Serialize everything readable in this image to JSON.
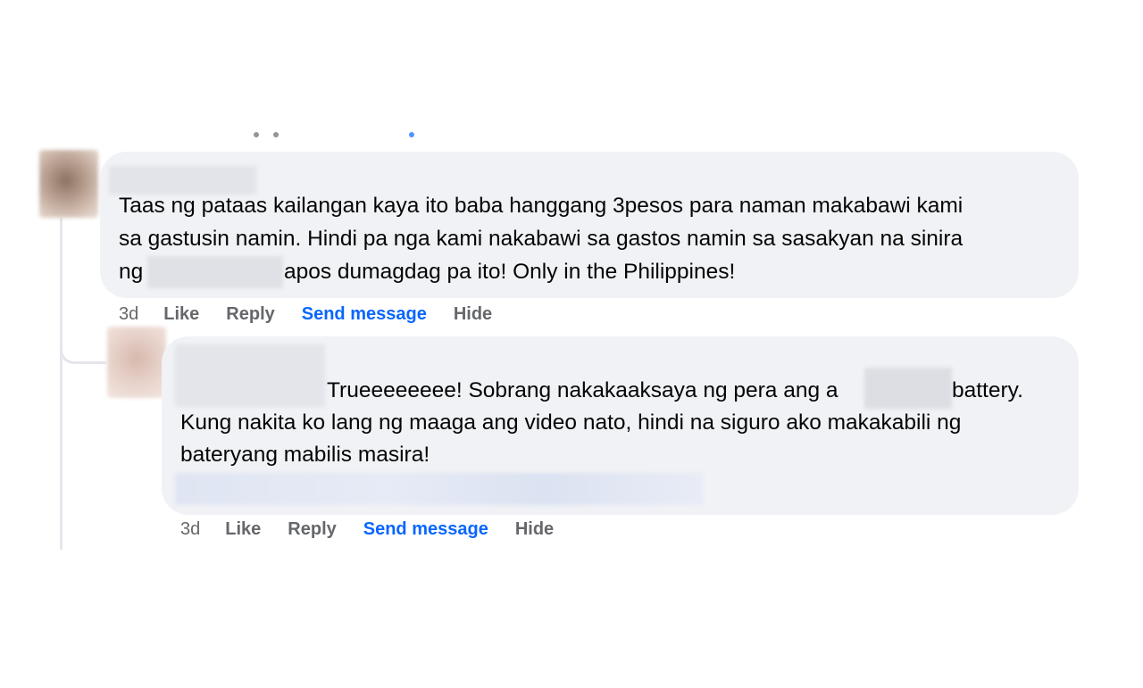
{
  "comment1": {
    "lines": [
      "Taas ng pataas kailangan kaya ito baba hanggang 3pesos para naman makabawi kami",
      "sa gastusin namin. Hindi pa nga kami nakabawi sa gastos namin sa sasakyan na sinira",
      "apos dumagdag pa ito! Only in the Philippines!"
    ],
    "line3_prefix": "ng",
    "time": "3d",
    "like": "Like",
    "reply": "Reply",
    "send_message": "Send message",
    "hide": "Hide"
  },
  "comment2": {
    "line1_start": "Trueeeeeeee! Sobrang nakakaaksaya ng pera ang a",
    "line1_end": "battery.",
    "line2": "Kung nakita ko lang ng maaga ang video nato, hindi na siguro ako makakabili ng",
    "line3": "bateryang mabilis masira!",
    "time": "3d",
    "like": "Like",
    "reply": "Reply",
    "send_message": "Send message",
    "hide": "Hide"
  },
  "colors": {
    "bubble": "#f0f2f5",
    "link": "#0866ff",
    "muted": "#65676b"
  }
}
